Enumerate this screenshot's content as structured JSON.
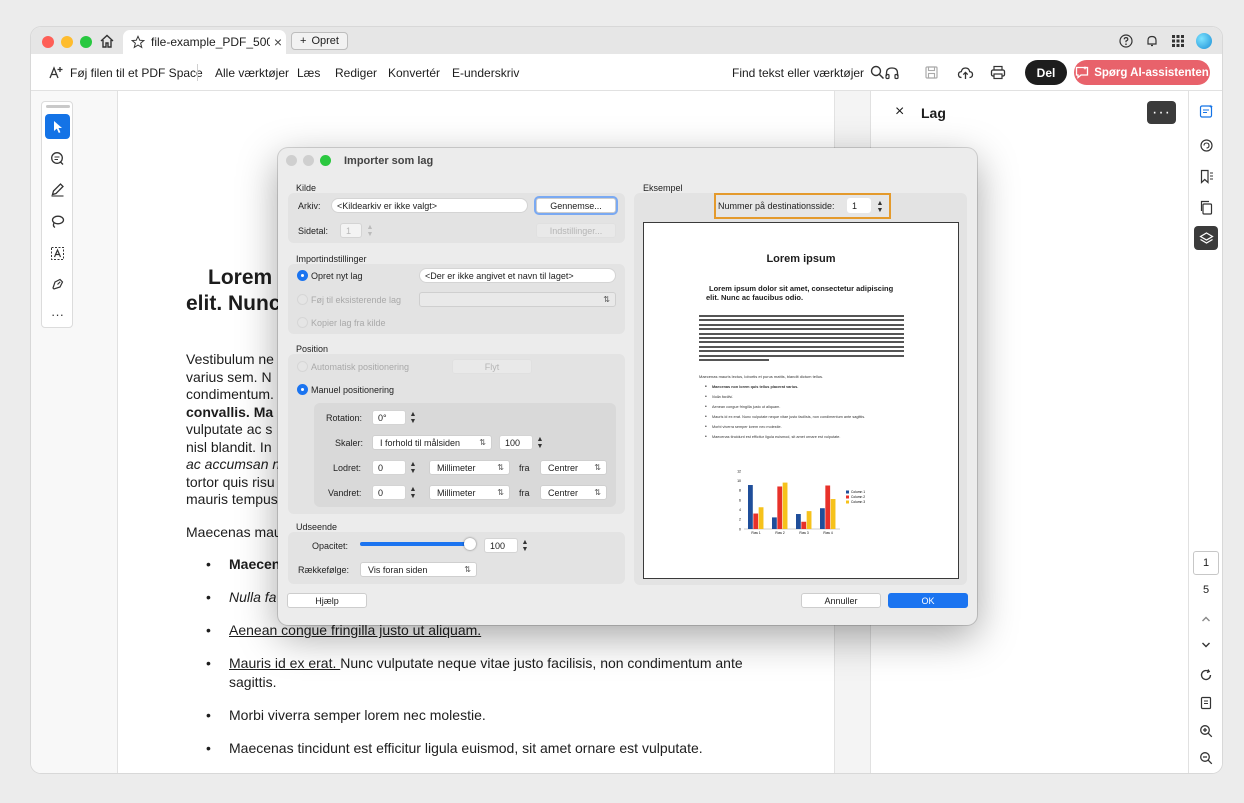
{
  "tabbar": {
    "tab_title": "file-example_PDF_500...",
    "tab_close": "×",
    "new_tab_label": "Opret",
    "new_tab_plus": "+"
  },
  "toolbar": {
    "add_to_pdf_space": "Føj filen til et PDF Space",
    "all_tools": "Alle værktøjer",
    "read": "Læs",
    "edit": "Rediger",
    "convert": "Konvertér",
    "esign": "E-underskriv",
    "find": "Find tekst eller værktøjer",
    "share": "Del",
    "ai_assistant": "Spørg AI-assistenten"
  },
  "tools": {
    "more": "···"
  },
  "document": {
    "heading": [
      "Lorem",
      "elit. Nunc"
    ],
    "paragraph_lines": [
      "Vestibulum ne",
      "varius sem. N",
      "condimentum.",
      "convallis. Ma",
      "vulputate ac s",
      "nisl blandit. In",
      "ac accumsan n",
      "tortor quis risu",
      "mauris tempus"
    ],
    "para2": "Maecenas mau",
    "list": [
      {
        "bold": "Maecen",
        "rest": ""
      },
      {
        "italic": "Nulla fa",
        "rest": ""
      },
      {
        "underline": "Aenean congue fringilla justo ut aliquam. ",
        "rest": ""
      },
      {
        "underline": "Mauris id ex erat. ",
        "rest": "Nunc vulputate neque vitae justo facilisis, non condimentum ante sagittis."
      },
      {
        "rest": "Morbi viverra semper lorem nec molestie."
      },
      {
        "rest": "Maecenas tincidunt est efficitur ligula euismod, sit amet ornare est vulputate."
      }
    ]
  },
  "panel": {
    "close": "×",
    "title": "Lag",
    "more": "···"
  },
  "page_nav": {
    "current": "1",
    "total": "5"
  },
  "dialog": {
    "title": "Importer som lag",
    "source_section": "Kilde",
    "file_label": "Arkiv:",
    "file_value": "<Kildearkiv er ikke valgt>",
    "browse_button": "Gennemse...",
    "page_label": "Sidetal:",
    "page_value": "1",
    "settings_button": "Indstillinger...",
    "import_section": "Importindstillinger",
    "create_new_layer": "Opret nyt lag",
    "layer_name_placeholder": "<Der er ikke angivet et navn til laget>",
    "add_to_existing": "Føj til eksisterende lag",
    "copy_layers": "Kopier lag fra kilde",
    "position_section": "Position",
    "auto_position": "Automatisk positionering",
    "move_button": "Flyt",
    "manual_position": "Manuel positionering",
    "rotation_label": "Rotation:",
    "rotation_value": "0°",
    "scale_label": "Skaler:",
    "scale_option": "I forhold til målsiden",
    "scale_value": "100",
    "vertical_label": "Lodret:",
    "vertical_value": "0",
    "vertical_unit": "Millimeter",
    "vertical_from": "fra",
    "vertical_anchor": "Centrer",
    "horizontal_label": "Vandret:",
    "horizontal_value": "0",
    "horizontal_unit": "Millimeter",
    "horizontal_from": "fra",
    "horizontal_anchor": "Centrer",
    "appearance_section": "Udseende",
    "opacity_label": "Opacitet:",
    "opacity_value": "100",
    "opacity_level": 1.0,
    "order_label": "Rækkefølge:",
    "order_value": "Vis foran siden",
    "help_button": "Hjælp",
    "preview_section": "Eksempel",
    "dest_page_label": "Nummer på destinationsside:",
    "dest_page_value": "1",
    "cancel_button": "Annuller",
    "ok_button": "OK"
  },
  "preview": {
    "title": "Lorem ipsum",
    "heading": [
      "Lorem ipsum dolor sit amet, consectetur adipiscing",
      "elit. Nunc ac faucibus odio."
    ],
    "para2": "Maecenas mauris lectus, lobortis et purus mattis, blandit dictum tellus.",
    "bullets": [
      "Maecenas non lorem quis tellus placerat varius.",
      "Nulla facilisi.",
      "Aenean congue fringilla justo ut aliquam.",
      "Mauris id ex erat. Nunc vulputate neque vitae justo facilisis, non condimentum ante sagittis.",
      "Morbi viverra semper lorem nec molestie.",
      "Maecenas tincidunt est efficitur ligula euismod, sit amet ornare est vulputate."
    ]
  },
  "chart_data": {
    "type": "bar",
    "categories": [
      "Row 1",
      "Row 2",
      "Row 3",
      "Row 4"
    ],
    "series": [
      {
        "name": "Column 1",
        "values": [
          9.1,
          2.4,
          3.1,
          4.3
        ],
        "color": "#1f4e9a"
      },
      {
        "name": "Column 2",
        "values": [
          3.2,
          8.8,
          1.5,
          9.0
        ],
        "color": "#e8312a"
      },
      {
        "name": "Column 3",
        "values": [
          4.5,
          9.6,
          3.7,
          6.2
        ],
        "color": "#f6c21b"
      }
    ],
    "yticks": [
      "0",
      "2",
      "4",
      "6",
      "8",
      "10",
      "12"
    ],
    "ylim": [
      0,
      12
    ],
    "legend": "right"
  },
  "colors": {
    "accent": "#1473e6",
    "ai": "#e8626b",
    "highlight": "#e49a2c",
    "primary_button": "#1b74f0"
  }
}
